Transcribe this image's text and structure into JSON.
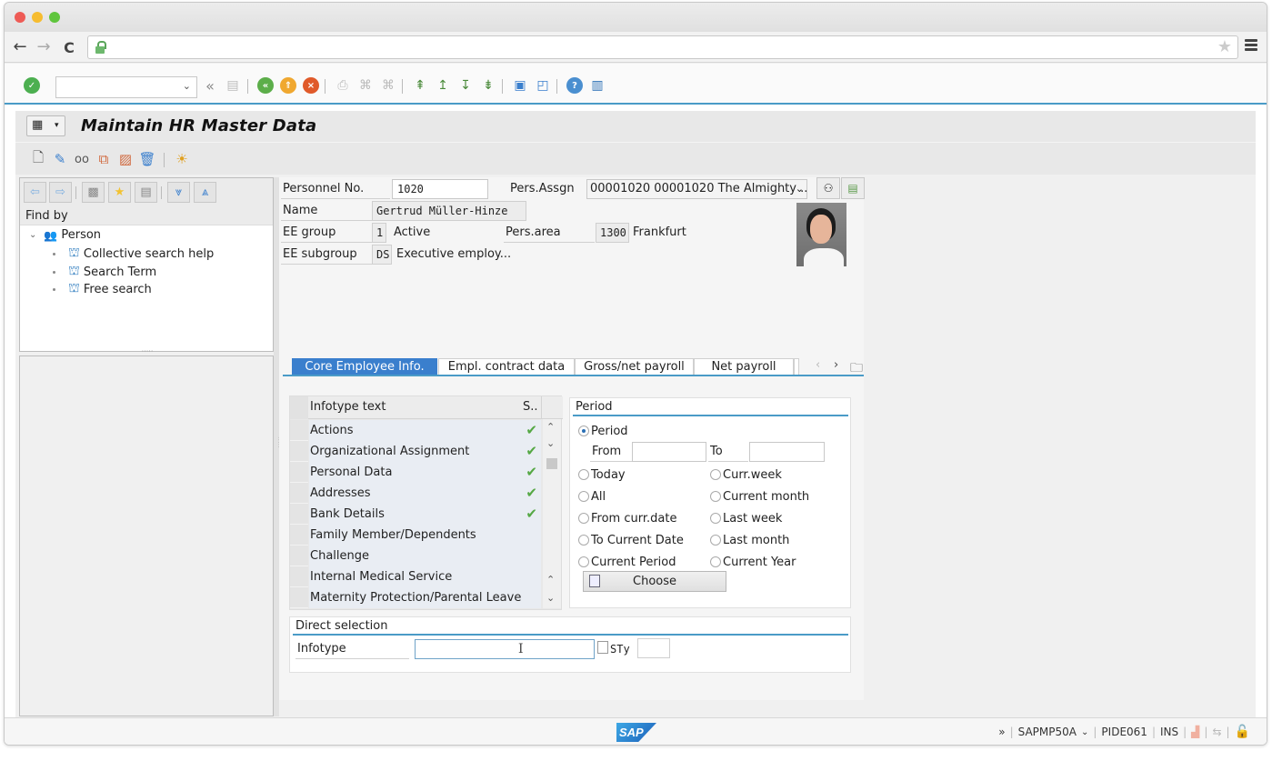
{
  "browser": {
    "url": "",
    "controls": {
      "back": "←",
      "forward": "→",
      "reload": "C"
    }
  },
  "system_toolbar": {
    "command_field_value": "",
    "icons": [
      "enter-icon",
      "command-field",
      "collapse-icon",
      "save-icon",
      "back-icon",
      "exit-icon",
      "cancel-icon",
      "print-icon",
      "find-icon",
      "find-next-icon",
      "first-page-icon",
      "previous-page-icon",
      "next-page-icon",
      "last-page-icon",
      "create-session-icon",
      "shortcut-icon",
      "help-icon",
      "layout-menu-icon"
    ]
  },
  "header": {
    "title": "Maintain HR Master Data"
  },
  "app_toolbar": {
    "icons": [
      "create-icon",
      "change-icon",
      "display-icon",
      "copy-icon",
      "delimit-icon",
      "delete-icon",
      "overview-icon"
    ]
  },
  "left_pane": {
    "find_by_label": "Find by",
    "tree": {
      "root": "Person",
      "children": [
        "Collective search help",
        "Search Term",
        "Free search"
      ]
    }
  },
  "employee": {
    "personnel_no_label": "Personnel No.",
    "personnel_no": "1020",
    "pers_assgn_label": "Pers.Assgn",
    "pers_assgn_value": "00001020 00001020 The Almighty ...",
    "name_label": "Name",
    "name": "Gertrud Müller-Hinze",
    "ee_group_label": "EE group",
    "ee_group_code": "1",
    "ee_group_text": "Active",
    "pers_area_label": "Pers.area",
    "pers_area_code": "1300",
    "pers_area_text": "Frankfurt",
    "ee_subgroup_label": "EE subgroup",
    "ee_subgroup_code": "DS",
    "ee_subgroup_text": "Executive employ..."
  },
  "tabs": [
    {
      "label": "Core Employee Info.",
      "active": true
    },
    {
      "label": "Empl. contract data",
      "active": false
    },
    {
      "label": "Gross/net payroll",
      "active": false
    },
    {
      "label": "Net payroll",
      "active": false
    }
  ],
  "infotype_table": {
    "columns": [
      "Infotype text",
      "S.."
    ],
    "rows": [
      {
        "text": "Actions",
        "status": true
      },
      {
        "text": "Organizational Assignment",
        "status": true
      },
      {
        "text": "Personal Data",
        "status": true
      },
      {
        "text": "Addresses",
        "status": true
      },
      {
        "text": "Bank Details",
        "status": true
      },
      {
        "text": "Family Member/Dependents",
        "status": false
      },
      {
        "text": "Challenge",
        "status": false
      },
      {
        "text": "Internal Medical Service",
        "status": false
      },
      {
        "text": "Maternity Protection/Parental Leave",
        "status": false
      }
    ]
  },
  "period": {
    "title": "Period",
    "selected": "Period",
    "period_option": "Period",
    "from_label": "From",
    "from_value": "",
    "to_label": "To",
    "to_value": "",
    "options_left": [
      "Today",
      "All",
      "From curr.date",
      "To Current Date",
      "Current Period"
    ],
    "options_right": [
      "Curr.week",
      "Current month",
      "Last week",
      "Last month",
      "Current Year"
    ],
    "choose_label": "Choose"
  },
  "direct_selection": {
    "title": "Direct selection",
    "infotype_label": "Infotype",
    "infotype_value": "",
    "sty_label": "STy",
    "sty_value": ""
  },
  "status_bar": {
    "logo": "SAP",
    "program": "SAPMP50A",
    "server": "PIDE061",
    "mode": "INS",
    "expand": "»"
  }
}
